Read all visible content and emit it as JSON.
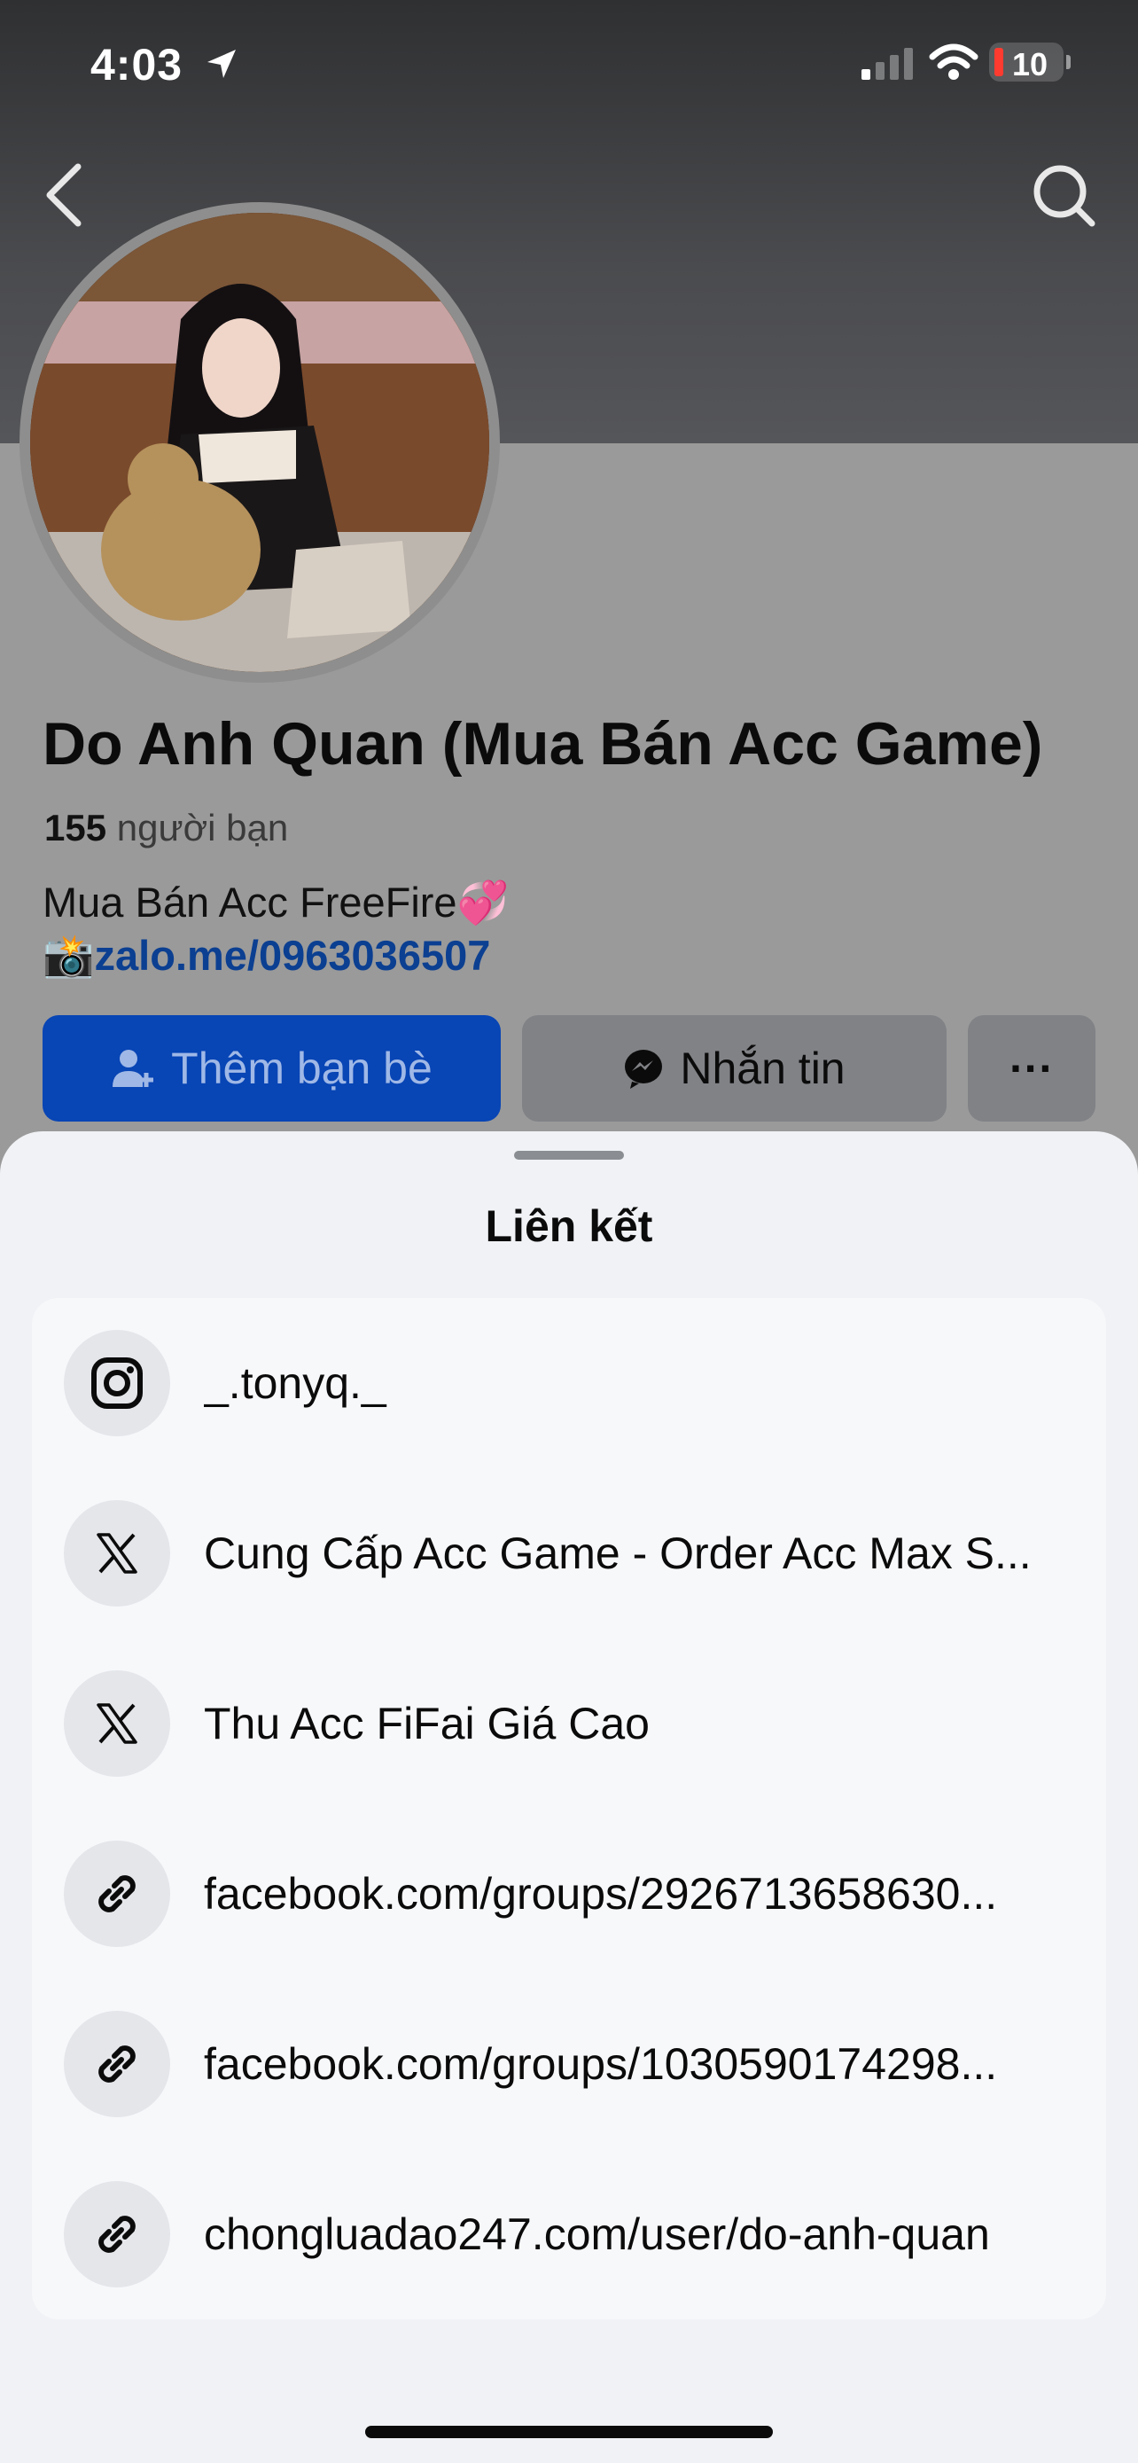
{
  "status_bar": {
    "time": "4:03",
    "battery": "10"
  },
  "profile": {
    "name": "Do Anh Quan (Mua Bán Acc Game)",
    "friends_count": "155",
    "friends_label": "người bạn",
    "bio_line1": "Mua Bán Acc FreeFire💞",
    "bio_prefix": "📸",
    "bio_link": "zalo.me/0963036507"
  },
  "actions": {
    "add_friend": "Thêm bạn bè",
    "message": "Nhắn tin",
    "more": "···"
  },
  "sheet": {
    "title": "Liên kết",
    "links": [
      {
        "icon": "instagram-icon",
        "text": "_.tonyq._"
      },
      {
        "icon": "x-icon",
        "text": "Cung Cấp Acc Game - Order Acc Max S..."
      },
      {
        "icon": "x-icon",
        "text": "Thu Acc FiFai Giá Cao"
      },
      {
        "icon": "link-icon",
        "text": "facebook.com/groups/2926713658630..."
      },
      {
        "icon": "link-icon",
        "text": "facebook.com/groups/1030590174298..."
      },
      {
        "icon": "link-icon",
        "text": "chongluadao247.com/user/do-anh-quan"
      }
    ]
  },
  "colors": {
    "primary": "#0845b5",
    "link": "#0b3f91",
    "sheet_bg": "#f0f2f5"
  }
}
